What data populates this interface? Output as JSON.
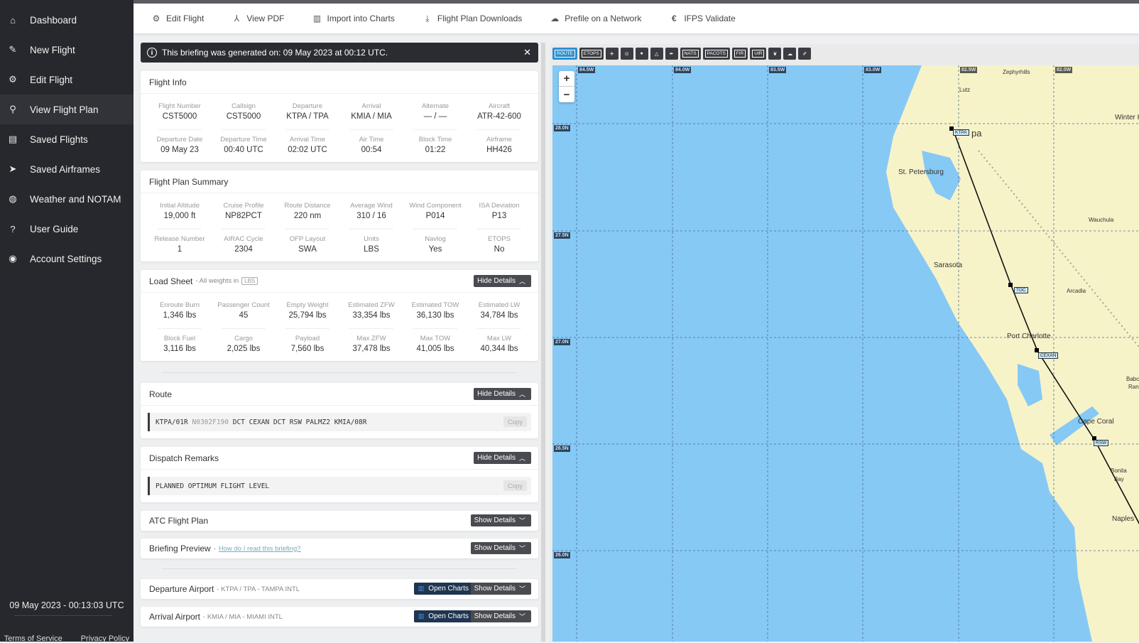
{
  "sidebar": {
    "items": [
      {
        "label": "Dashboard",
        "icon": "home-icon"
      },
      {
        "label": "New Flight",
        "icon": "pencil-icon"
      },
      {
        "label": "Edit Flight",
        "icon": "gear-icon"
      },
      {
        "label": "View Flight Plan",
        "icon": "search-icon",
        "active": true
      },
      {
        "label": "Saved Flights",
        "icon": "calendar-icon"
      },
      {
        "label": "Saved Airframes",
        "icon": "paper-plane-icon"
      },
      {
        "label": "Weather and NOTAM",
        "icon": "globe-icon"
      },
      {
        "label": "User Guide",
        "icon": "question-icon"
      },
      {
        "label": "Account Settings",
        "icon": "user-circle-icon"
      }
    ],
    "clock": "09 May 2023 - 00:13:03 UTC",
    "links": [
      "Terms of Service",
      "Privacy Policy"
    ]
  },
  "toolbar": {
    "items": [
      {
        "label": "Edit Flight",
        "icon": "gear-icon"
      },
      {
        "label": "View PDF",
        "icon": "pdf-icon"
      },
      {
        "label": "Import into Charts",
        "icon": "charts-icon"
      },
      {
        "label": "Flight Plan Downloads",
        "icon": "download-icon"
      },
      {
        "label": "Prefile on a Network",
        "icon": "cloud-upload-icon"
      },
      {
        "label": "IFPS Validate",
        "icon": "euro-icon"
      }
    ]
  },
  "alert": {
    "text": "This briefing was generated on: 09 May 2023 at 00:12 UTC."
  },
  "flight_info": {
    "title": "Flight Info",
    "row1": [
      {
        "label": "Flight Number",
        "value": "CST5000"
      },
      {
        "label": "Callsign",
        "value": "CST5000"
      },
      {
        "label": "Departure",
        "value": "KTPA / TPA"
      },
      {
        "label": "Arrival",
        "value": "KMIA / MIA"
      },
      {
        "label": "Alternate",
        "value": "— / —"
      },
      {
        "label": "Aircraft",
        "value": "ATR-42-600"
      }
    ],
    "row2": [
      {
        "label": "Departure Date",
        "value": "09 May 23"
      },
      {
        "label": "Departure Time",
        "value": "00:40 UTC"
      },
      {
        "label": "Arrival Time",
        "value": "02:02 UTC"
      },
      {
        "label": "Air Time",
        "value": "00:54"
      },
      {
        "label": "Block Time",
        "value": "01:22"
      },
      {
        "label": "Airframe",
        "value": "HH426"
      }
    ]
  },
  "summary": {
    "title": "Flight Plan Summary",
    "row1": [
      {
        "label": "Initial Altitude",
        "value": "19,000 ft"
      },
      {
        "label": "Cruise Profile",
        "value": "NP82PCT"
      },
      {
        "label": "Route Distance",
        "value": "220 nm"
      },
      {
        "label": "Average Wind",
        "value": "310 / 16"
      },
      {
        "label": "Wind Component",
        "value": "P014"
      },
      {
        "label": "ISA Deviation",
        "value": "P13"
      }
    ],
    "row2": [
      {
        "label": "Release Number",
        "value": "1"
      },
      {
        "label": "AIRAC Cycle",
        "value": "2304"
      },
      {
        "label": "OFP Layout",
        "value": "SWA"
      },
      {
        "label": "Units",
        "value": "LBS"
      },
      {
        "label": "Navlog",
        "value": "Yes"
      },
      {
        "label": "ETOPS",
        "value": "No"
      }
    ]
  },
  "loadsheet": {
    "title": "Load Sheet",
    "subtitle": "- All weights in",
    "unit": "LBS",
    "toggle": "Hide Details",
    "row1": [
      {
        "label": "Enroute Burn",
        "value": "1,346 lbs"
      },
      {
        "label": "Passenger Count",
        "value": "45"
      },
      {
        "label": "Empty Weight",
        "value": "25,794 lbs"
      },
      {
        "label": "Estimated ZFW",
        "value": "33,354 lbs"
      },
      {
        "label": "Estimated TOW",
        "value": "36,130 lbs"
      },
      {
        "label": "Estimated LW",
        "value": "34,784 lbs"
      }
    ],
    "row2": [
      {
        "label": "Block Fuel",
        "value": "3,116 lbs"
      },
      {
        "label": "Cargo",
        "value": "2,025 lbs"
      },
      {
        "label": "Payload",
        "value": "7,560 lbs"
      },
      {
        "label": "Max ZFW",
        "value": "37,478 lbs"
      },
      {
        "label": "Max TOW",
        "value": "41,005 lbs"
      },
      {
        "label": "Max LW",
        "value": "40,344 lbs"
      }
    ]
  },
  "route": {
    "title": "Route",
    "toggle": "Hide Details",
    "origin": "KTPA/01R",
    "speed_level": "N0302F190",
    "rest": "DCT CEXAN DCT RSW PALMZ2 KMIA/08R",
    "copy": "Copy"
  },
  "remarks": {
    "title": "Dispatch Remarks",
    "toggle": "Hide Details",
    "text": "PLANNED OPTIMUM FLIGHT LEVEL",
    "copy": "Copy"
  },
  "atc": {
    "title": "ATC Flight Plan",
    "toggle": "Show Details"
  },
  "briefing": {
    "title": "Briefing Preview",
    "link": "How do I read this briefing?",
    "toggle": "Show Details"
  },
  "departure": {
    "title": "Departure Airport",
    "sub": "- KTPA / TPA - TAMPA INTL",
    "charts": "Open Charts",
    "toggle": "Show Details"
  },
  "arrival": {
    "title": "Arrival Airport",
    "sub": "- KMIA / MIA - MIAMI INTL",
    "charts": "Open Charts",
    "toggle": "Show Details"
  },
  "map": {
    "tools": [
      "ROUTE",
      "ETOPS",
      "",
      "",
      "",
      "",
      "",
      "NATS",
      "PACOTS",
      "FIR",
      "UIR",
      "",
      "",
      ""
    ],
    "tool_icons": [
      "route-layer",
      "etops-layer",
      "airways-icon",
      "vor-icon",
      "weather-radar-icon",
      "triangle-icon",
      "feather-icon",
      "nats-layer",
      "pacots-layer",
      "fir-layer",
      "uir-layer",
      "leaf-icon",
      "cloud-icon",
      "pin-icon"
    ],
    "zoom_in": "+",
    "zoom_out": "−",
    "lon_labels": [
      "84.5W",
      "84.0W",
      "83.5W",
      "83.0W",
      "82.5W",
      "82.0W"
    ],
    "lat_labels": [
      "28.0N",
      "27.5N",
      "27.0N",
      "26.5N",
      "26.0N"
    ],
    "cities": [
      "Zephyrhills",
      "Lutz",
      "Winter Ha",
      "pa",
      "St. Petersburg",
      "Wauchula",
      "Sarasota",
      "Arcadia",
      "Port Charlotte",
      "Babcoc",
      "Ranch",
      "Cape Coral",
      "Bonita",
      "Bay",
      "Naples"
    ],
    "waypoints": [
      "KTPA",
      "TOC",
      "CEXAN",
      "RSW"
    ]
  }
}
